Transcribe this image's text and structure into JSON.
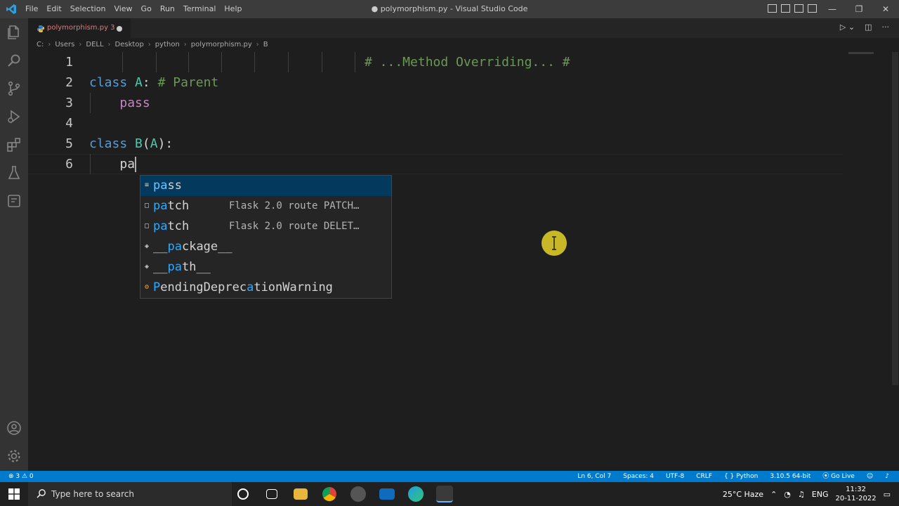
{
  "titlebar": {
    "menu": [
      "File",
      "Edit",
      "Selection",
      "View",
      "Go",
      "Run",
      "Terminal",
      "Help"
    ],
    "title": "● polymorphism.py - Visual Studio Code",
    "controls": [
      "—",
      "❐",
      "✕"
    ]
  },
  "tab": {
    "label": "polymorphism.py 3"
  },
  "breadcrumb": [
    "C:",
    "Users",
    "DELL",
    "Desktop",
    "python",
    "polymorphism.py",
    "B"
  ],
  "editor": {
    "line_numbers": [
      "1",
      "2",
      "3",
      "4",
      "5",
      "6"
    ],
    "line1_comment": "# ...Method Overriding... #",
    "line2": {
      "kw": "class",
      "name": "A",
      "colon": ":",
      "comment": "# Parent"
    },
    "line3": {
      "kw": "pass"
    },
    "line5": {
      "kw": "class",
      "name": "B",
      "paren_open": "(",
      "base": "A",
      "paren_close": "):"
    },
    "line6": {
      "typed": "pa"
    }
  },
  "suggestions": [
    {
      "match": "pa",
      "rest": "ss",
      "detail": "",
      "icon": "keyword-icon"
    },
    {
      "match": "pa",
      "rest": "tch",
      "detail": "Flask 2.0 route PATCH…",
      "icon": "snippet-icon"
    },
    {
      "match": "pa",
      "rest": "tch",
      "detail": "Flask 2.0 route DELET…",
      "icon": "snippet-icon"
    },
    {
      "pre": "__",
      "match": "pa",
      "rest": "ckage__",
      "detail": "",
      "icon": "variable-icon"
    },
    {
      "pre": "__",
      "match": "pa",
      "rest": "th__",
      "detail": "",
      "icon": "variable-icon"
    },
    {
      "pre": "",
      "match": "P",
      "mid": "endingDeprec",
      "match2": "a",
      "rest": "tionWarning",
      "detail": "",
      "icon": "class-icon"
    }
  ],
  "statusbar": {
    "problems": "⊗ 3  ⚠ 0",
    "position": "Ln 6, Col 7",
    "spaces": "Spaces: 4",
    "encoding": "UTF-8",
    "eol": "CRLF",
    "language": "{ } Python",
    "interpreter": "3.10.5 64-bit",
    "golive": "⦿ Go Live"
  },
  "taskbar": {
    "search_placeholder": "Type here to search",
    "weather": "25°C Haze",
    "lang": "ENG",
    "time": "11:32",
    "date": "20-11-2022"
  },
  "colors": {
    "accent": "#007acc",
    "keyword": "#569cd6",
    "class_name": "#4ec9b0",
    "comment": "#6a9955",
    "control": "#c586c0"
  }
}
